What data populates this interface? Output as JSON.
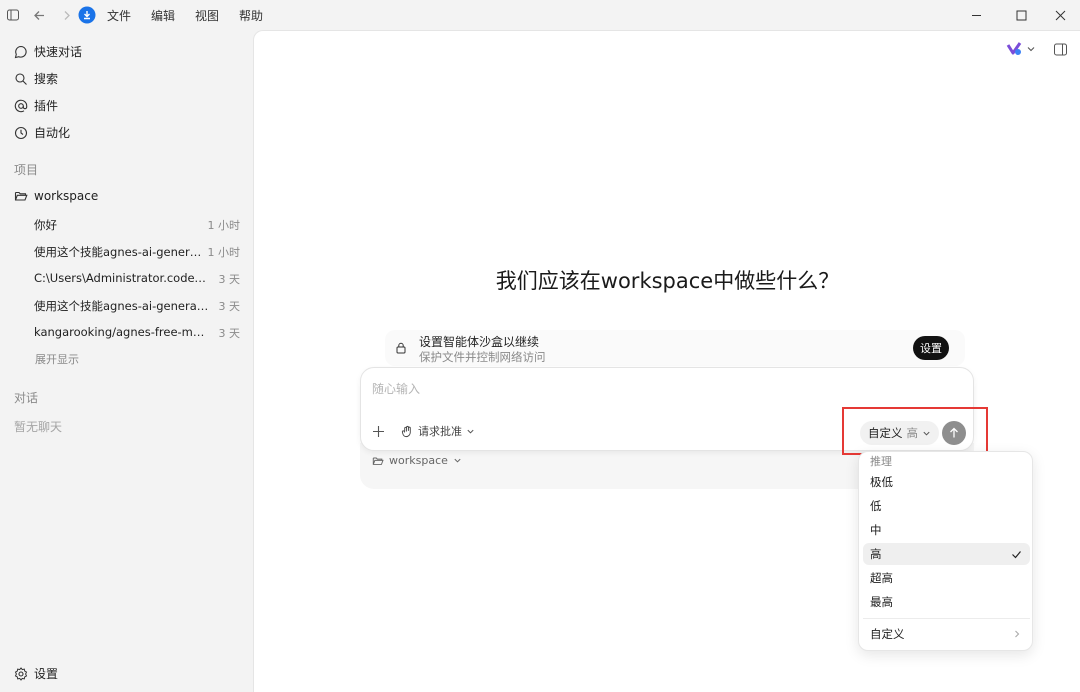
{
  "menu": [
    "文件",
    "编辑",
    "视图",
    "帮助"
  ],
  "sidebar": {
    "nav": [
      {
        "label": "快速对话",
        "icon": "chat-bubble-icon"
      },
      {
        "label": "搜索",
        "icon": "search-icon"
      },
      {
        "label": "插件",
        "icon": "at-sign-icon"
      },
      {
        "label": "自动化",
        "icon": "clock-icon"
      }
    ],
    "projects_label": "项目",
    "project_name": "workspace",
    "threads": [
      {
        "title": "你好",
        "time": "1 小时"
      },
      {
        "title": "使用这个技能agnes-ai-generati...",
        "time": "1 小时"
      },
      {
        "title": "C:\\Users\\Administrator.codex\\ski...",
        "time": "3 天"
      },
      {
        "title": "使用这个技能agnes-ai-generatio...",
        "time": "3 天"
      },
      {
        "title": "kangarooking/agnes-free-model...",
        "time": "3 天"
      }
    ],
    "show_more": "展开显示",
    "conversations_label": "对话",
    "no_chats": "暂无聊天",
    "settings_label": "设置"
  },
  "main": {
    "heading": "我们应该在workspace中做些什么？",
    "banner": {
      "title": "设置智能体沙盒以继续",
      "subtitle": "保护文件并控制网络访问",
      "button": "设置"
    },
    "composer": {
      "placeholder": "随心输入",
      "approval_label": "请求批准",
      "model_label": "自定义",
      "model_level": "高"
    },
    "workspace_selector": "workspace"
  },
  "dropdown": {
    "header": "推理",
    "items": [
      "极低",
      "低",
      "中",
      "高",
      "超高",
      "最高"
    ],
    "selected": "高",
    "custom": "自定义"
  },
  "colors": {
    "highlight_border": "#e53935",
    "app_accent": "#1a73e8"
  }
}
